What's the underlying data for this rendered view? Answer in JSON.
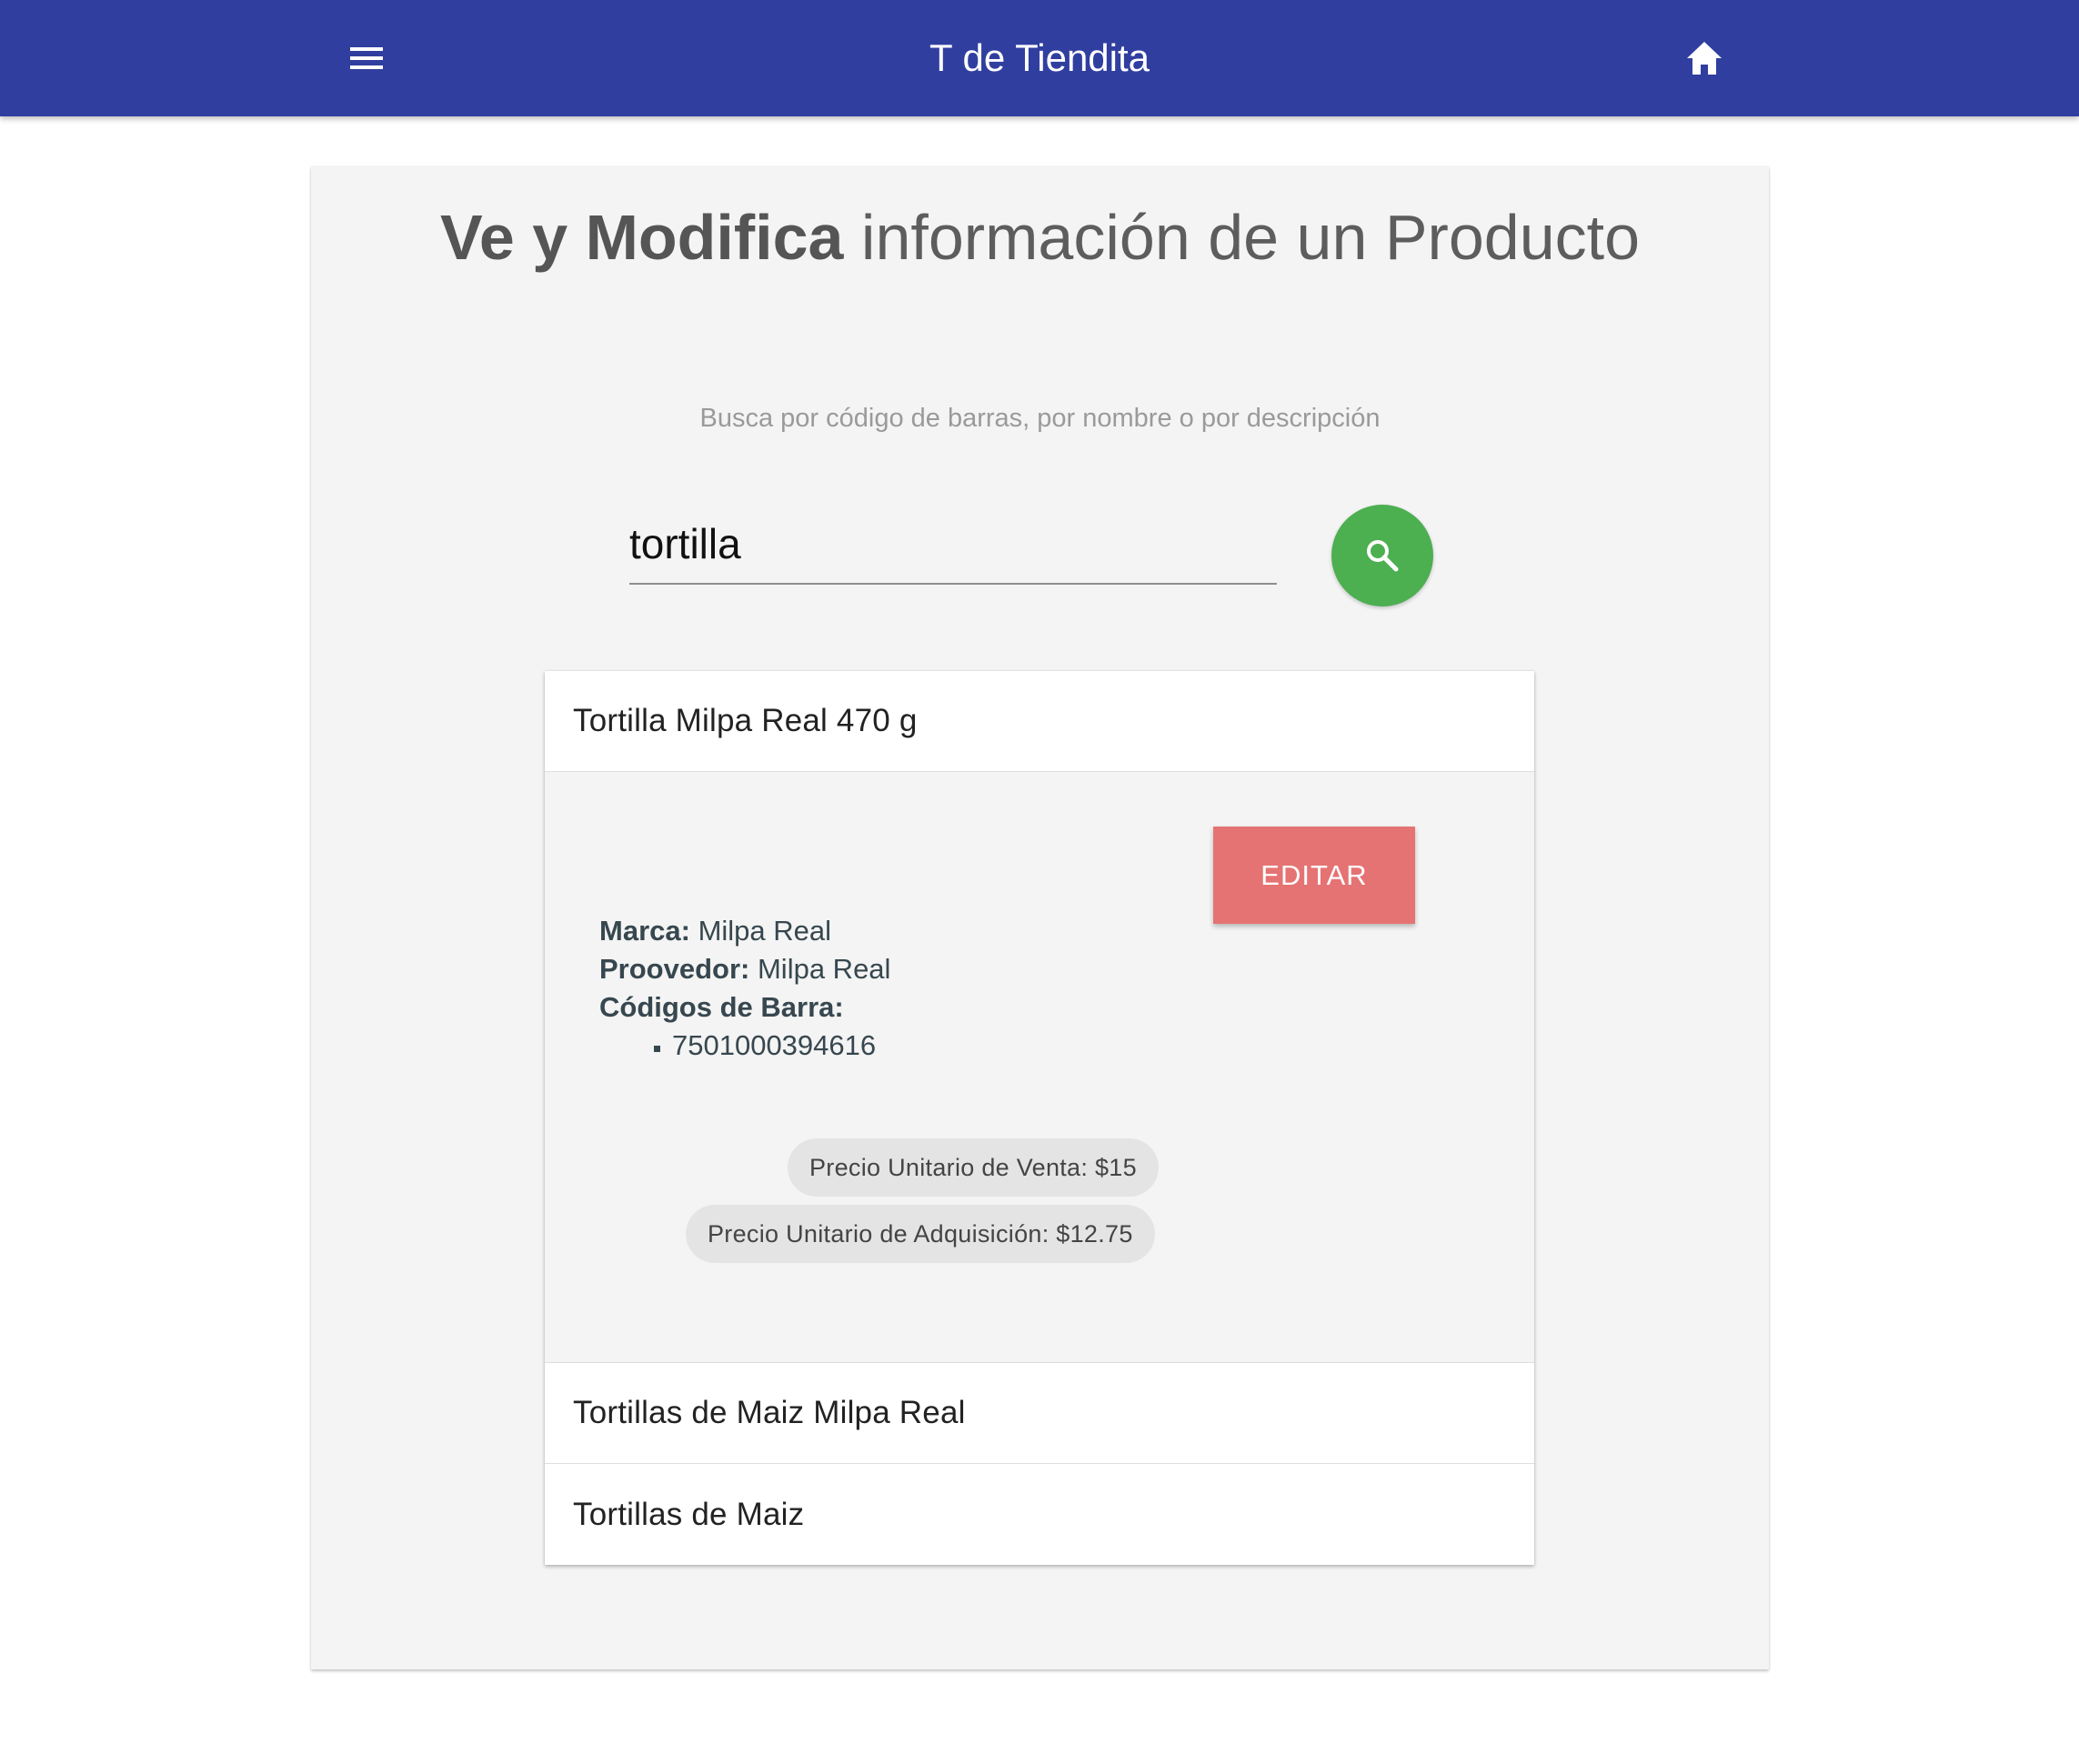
{
  "navbar": {
    "title": "T de Tiendita",
    "menu_icon": "menu-icon",
    "home_icon": "home-icon",
    "color": "#303f9f"
  },
  "page": {
    "title_bold": "Ve y Modifica",
    "title_rest": " información de un Producto",
    "hint": "Busca por código de barras, por nombre o por descripción"
  },
  "search": {
    "value": "tortilla",
    "button_icon": "search-icon",
    "button_color": "#4caf50"
  },
  "results": [
    {
      "name": "Tortilla Milpa Real 470 g",
      "expanded": true,
      "edit_label": "EDITAR",
      "marca_label": "Marca:",
      "marca": "Milpa Real",
      "proveedor_label": "Proovedor:",
      "proveedor": "Milpa Real",
      "codigos_label": "Códigos de Barra:",
      "codigos": [
        "7501000394616"
      ],
      "precio_venta": "Precio Unitario de Venta: $15",
      "precio_adquisicion": "Precio Unitario de Adquisición: $12.75"
    },
    {
      "name": "Tortillas de Maiz Milpa Real",
      "expanded": false
    },
    {
      "name": "Tortillas de Maiz",
      "expanded": false
    }
  ],
  "colors": {
    "edit_button": "#e57373",
    "card_background": "#f4f4f4"
  }
}
